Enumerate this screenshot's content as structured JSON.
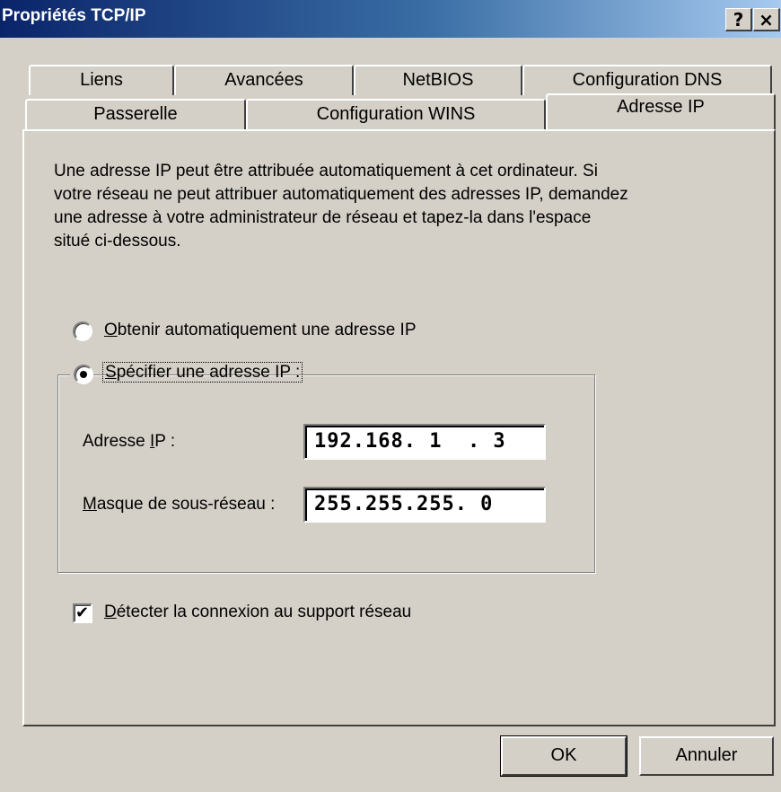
{
  "window": {
    "title": "Propriétés TCP/IP",
    "help_button": "?",
    "close_button": "×"
  },
  "tabs": {
    "back_row": [
      "Liens",
      "Avancées",
      "NetBIOS",
      "Configuration DNS"
    ],
    "front_row": [
      "Passerelle",
      "Configuration WINS",
      "Adresse IP"
    ],
    "selected": "Adresse IP"
  },
  "description": "Une adresse IP peut être attribuée automatiquement à cet ordinateur. Si votre réseau ne peut attribuer automatiquement des adresses IP, demandez une adresse à votre administrateur de réseau et tapez-la dans l'espace situé ci-dessous.",
  "options": {
    "auto_label_mnemonic": "O",
    "auto_label_rest": "btenir automatiquement une adresse IP",
    "auto_selected": false,
    "specify_label_mnemonic": "S",
    "specify_label_rest": "pécifier une adresse IP :",
    "specify_selected": true
  },
  "fields": {
    "ip_label_prefix": "Adresse ",
    "ip_label_mnemonic": "I",
    "ip_label_suffix": "P :",
    "ip_value": "192.168. 1  . 3",
    "mask_label_mnemonic": "M",
    "mask_label_rest": "asque de sous-réseau :",
    "mask_value": "255.255.255. 0"
  },
  "detect": {
    "label_mnemonic": "D",
    "label_rest": "étecter la connexion au support réseau",
    "checked": true
  },
  "buttons": {
    "ok": "OK",
    "cancel": "Annuler"
  }
}
